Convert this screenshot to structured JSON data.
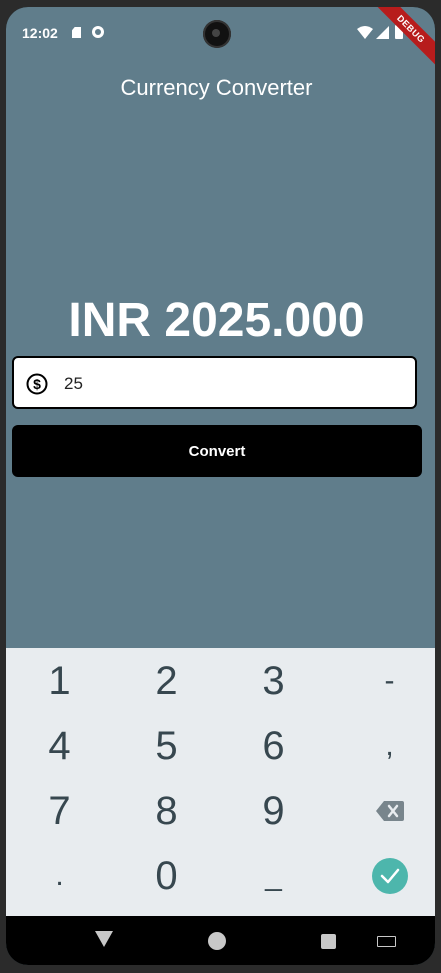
{
  "status_bar": {
    "time": "12:02",
    "debug_label": "DEBUG"
  },
  "app_bar": {
    "title": "Currency Converter"
  },
  "result": {
    "text": "INR 2025.000"
  },
  "amount_input": {
    "value": "25"
  },
  "convert_button": {
    "label": "Convert"
  },
  "keyboard": {
    "row1": [
      "1",
      "2",
      "3",
      "-"
    ],
    "row2": [
      "4",
      "5",
      "6",
      ","
    ],
    "row3": [
      "7",
      "8",
      "9"
    ],
    "row4": [
      ".",
      "0",
      "_"
    ]
  },
  "colors": {
    "background": "#607d8b",
    "done_key": "#4db6ac",
    "debug_banner": "#b71c1c"
  }
}
